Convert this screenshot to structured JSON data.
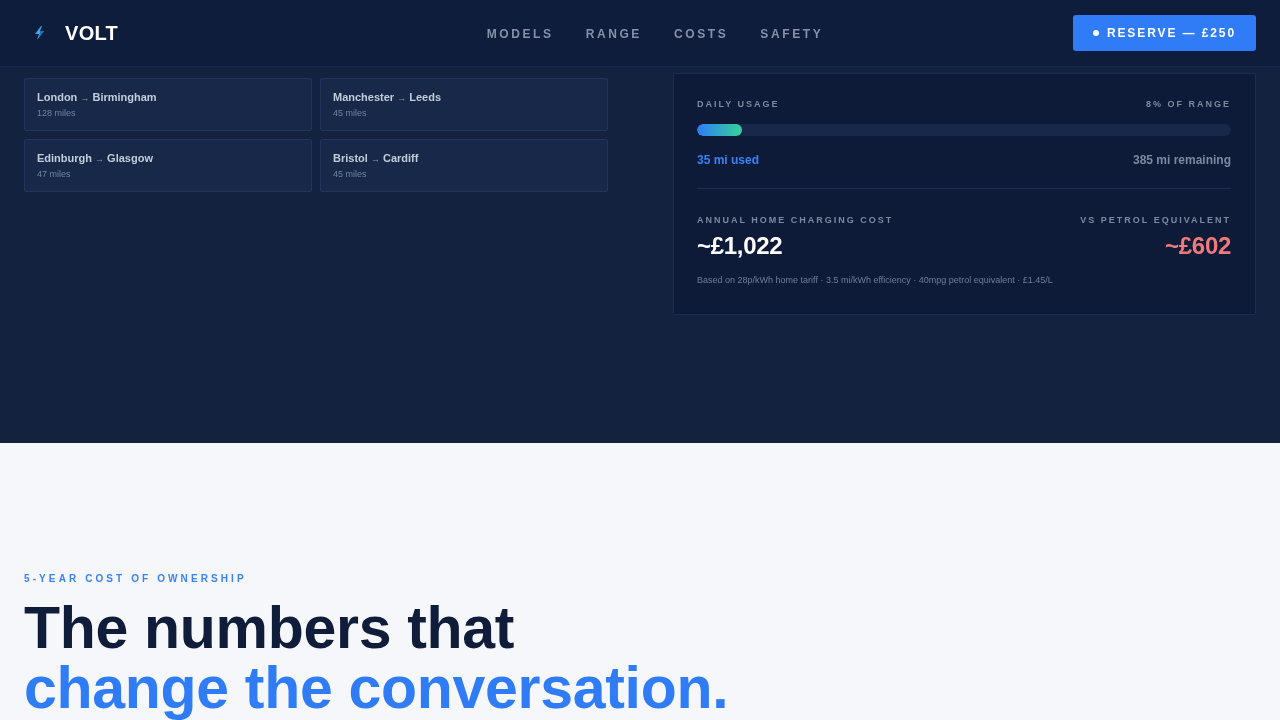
{
  "nav": {
    "logo": "VOLT",
    "links": [
      {
        "label": "MODELS"
      },
      {
        "label": "RANGE"
      },
      {
        "label": "COSTS"
      },
      {
        "label": "SAFETY"
      }
    ],
    "cta": "RESERVE — £250"
  },
  "routes": [
    {
      "from": "London",
      "arrow": "→",
      "to": "Birmingham",
      "distance": "128 miles"
    },
    {
      "from": "Manchester",
      "arrow": "→",
      "to": "Leeds",
      "distance": "45 miles"
    },
    {
      "from": "Edinburgh",
      "arrow": "→",
      "to": "Glasgow",
      "distance": "47 miles"
    },
    {
      "from": "Bristol",
      "arrow": "→",
      "to": "Cardiff",
      "distance": "45 miles"
    }
  ],
  "usage": {
    "label": "DAILY USAGE",
    "share": "8% OF RANGE",
    "level": 0.084,
    "used": "35 mi used",
    "remaining": "385 mi remaining"
  },
  "costs": [
    {
      "kind": "ev",
      "label": "ANNUAL HOME CHARGING COST",
      "value": "~£1,022"
    },
    {
      "kind": "petrol",
      "label": "VS PETROL EQUIVALENT",
      "value": "~£602"
    }
  ],
  "footnote": "Based on 28p/kWh home tariff · 3.5 mi/kWh efficiency · 40mpg petrol equivalent · £1.45/L",
  "ownership": {
    "eyebrow": "5-YEAR COST OF OWNERSHIP",
    "title": "The numbers that",
    "title_accent": "change the conversation."
  }
}
